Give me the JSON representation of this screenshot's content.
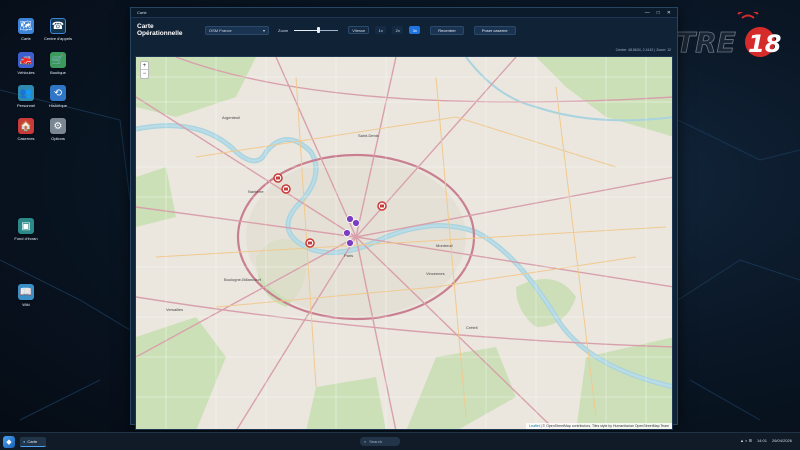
{
  "desktop": {
    "icons": [
      {
        "label": "Carte",
        "icon": "map-icon",
        "color": "#3c84d8"
      },
      {
        "label": "Centre d'appels",
        "icon": "phone-icon",
        "color": "#11344f"
      },
      {
        "label": "Véhicules",
        "icon": "truck-icon",
        "color": "#3c5fd0"
      },
      {
        "label": "Boutique",
        "icon": "shop-icon",
        "color": "#3a9b5c"
      },
      {
        "label": "Personnel",
        "icon": "people-icon",
        "color": "#2f8ab0"
      },
      {
        "label": "Historique",
        "icon": "history-icon",
        "color": "#2f77c6"
      },
      {
        "label": "Casernes",
        "icon": "firestation-icon",
        "color": "#c93a3a"
      },
      {
        "label": "Options",
        "icon": "gear-icon",
        "color": "#7a8793"
      },
      {
        "label": "Fond d'écran",
        "icon": "wallpaper-icon",
        "color": "#2b8a89"
      },
      {
        "label": "Wiki",
        "icon": "wiki-icon",
        "color": "#3a8fc9"
      }
    ]
  },
  "logo": {
    "text": "TRE18",
    "accent": "#d62b2b"
  },
  "window": {
    "title": "Carte",
    "toolbar": {
      "heading": "Carte Opérationnelle",
      "map_style": "OSM France",
      "zoom_label": "Zoom",
      "zoom_level_fraction": 0.55,
      "speed_label": "Vitesse",
      "speeds": [
        "1x",
        "2x",
        "3x"
      ],
      "active_speed": "3x",
      "recenter_label": "Recentrer",
      "place_station_label": "Poser caserne",
      "coordinates": "Centre: 48.8634, 2.4142 | Zoom: 12"
    },
    "map": {
      "zoom_in": "+",
      "zoom_out": "−",
      "attribution_leaflet": "Leaflet",
      "attribution_rest": " | © OpenStreetMap contributors, Tiles style by Humanitarian OpenStreetMap Team",
      "places": [
        "Argenteuil",
        "Saint-Denis",
        "Paris",
        "Montreuil",
        "Vincennes",
        "Boulogne-Billancourt",
        "Nanterre",
        "Versailles",
        "Créteil"
      ]
    }
  },
  "taskbar": {
    "task_label": "Carte",
    "search_placeholder": "Search",
    "tray_icons": "▲ ◐ ⊞",
    "time": "14:01",
    "date": "26/04/2026"
  }
}
